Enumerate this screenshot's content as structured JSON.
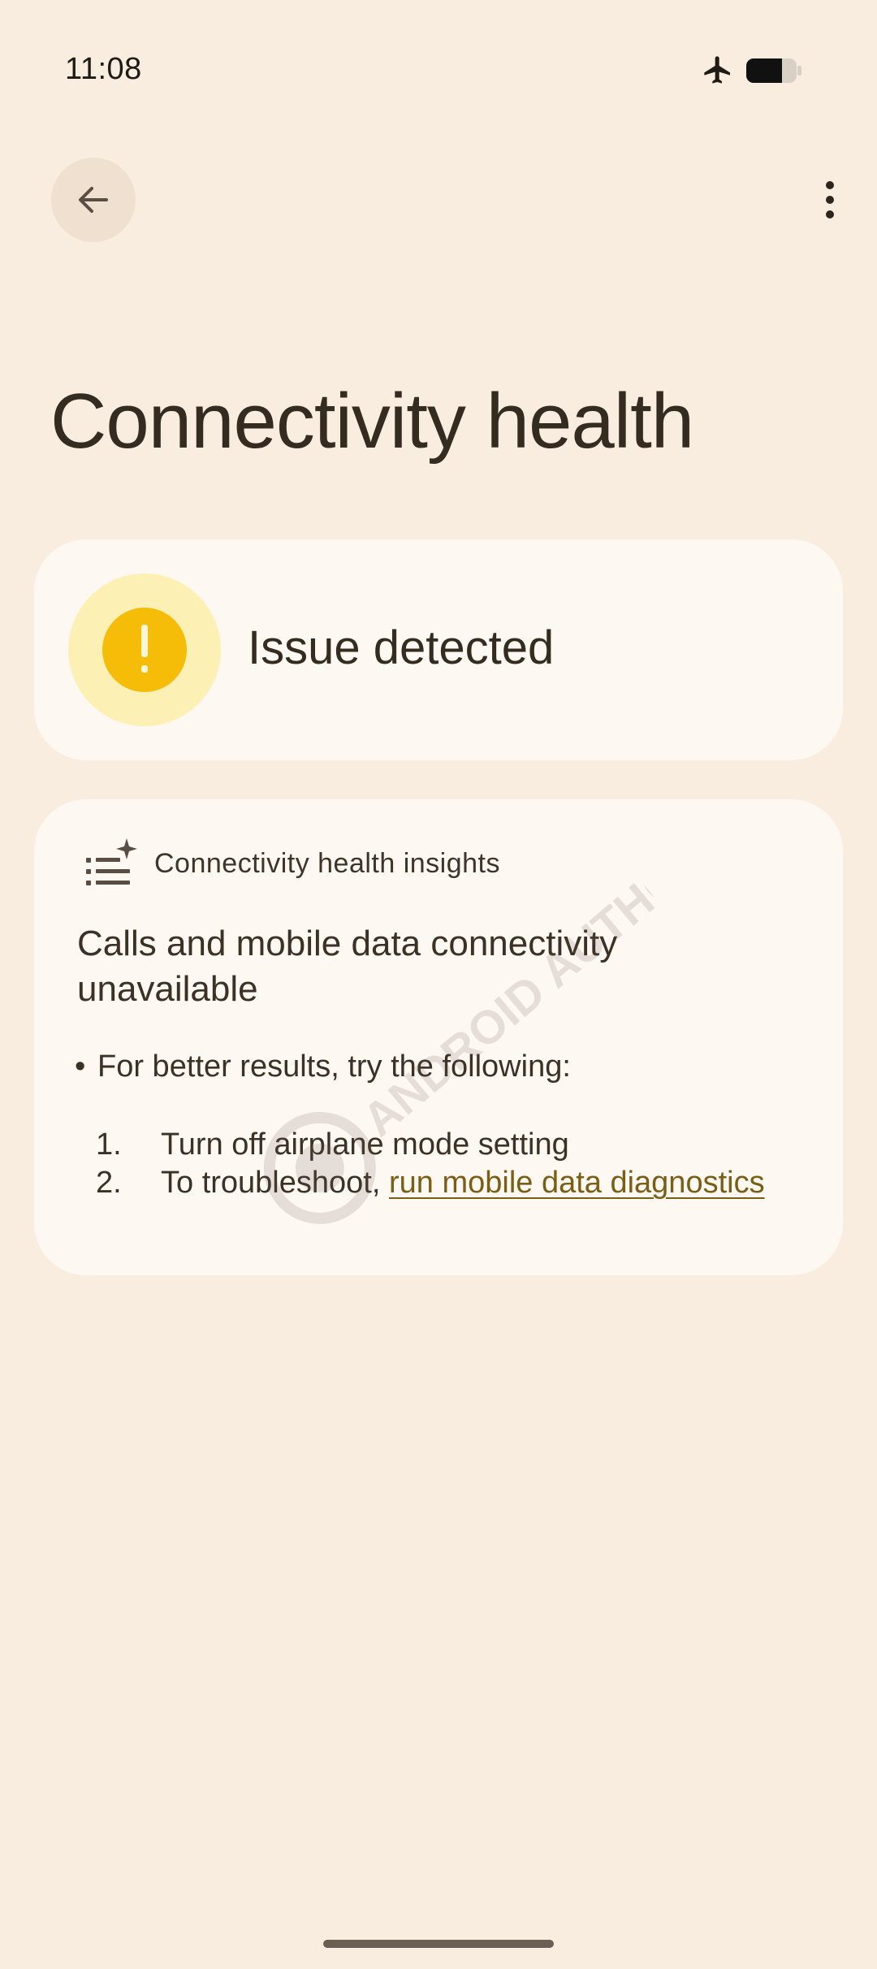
{
  "status_bar": {
    "time": "11:08",
    "icons": [
      "airplane-icon",
      "battery-icon"
    ],
    "battery_level": 0.7
  },
  "app_bar": {
    "back_icon": "arrow-back-icon",
    "overflow_icon": "more-vert-icon"
  },
  "page": {
    "title": "Connectivity health"
  },
  "status_card": {
    "icon": "warning-icon",
    "icon_glyph": "!",
    "label": "Issue detected",
    "accent": "#f6bd08",
    "halo": "#fdf0b5"
  },
  "insights_card": {
    "icon": "list-sparkle-icon",
    "header": "Connectivity health insights",
    "headline": "Calls and mobile data connectivity unavailable",
    "bullet": "For better results, try the following:",
    "steps": [
      {
        "number": "1.",
        "text": "Turn off airplane mode setting"
      },
      {
        "number": "2.",
        "text": "To troubleshoot, ",
        "link": "run mobile data diagnostics"
      }
    ],
    "link_color": "#7b5e16"
  },
  "watermark": {
    "text": "ANDROID AUTHORITY"
  },
  "colors": {
    "background": "#f9ede0",
    "card": "#fef8f3",
    "text": "#3b3125"
  }
}
